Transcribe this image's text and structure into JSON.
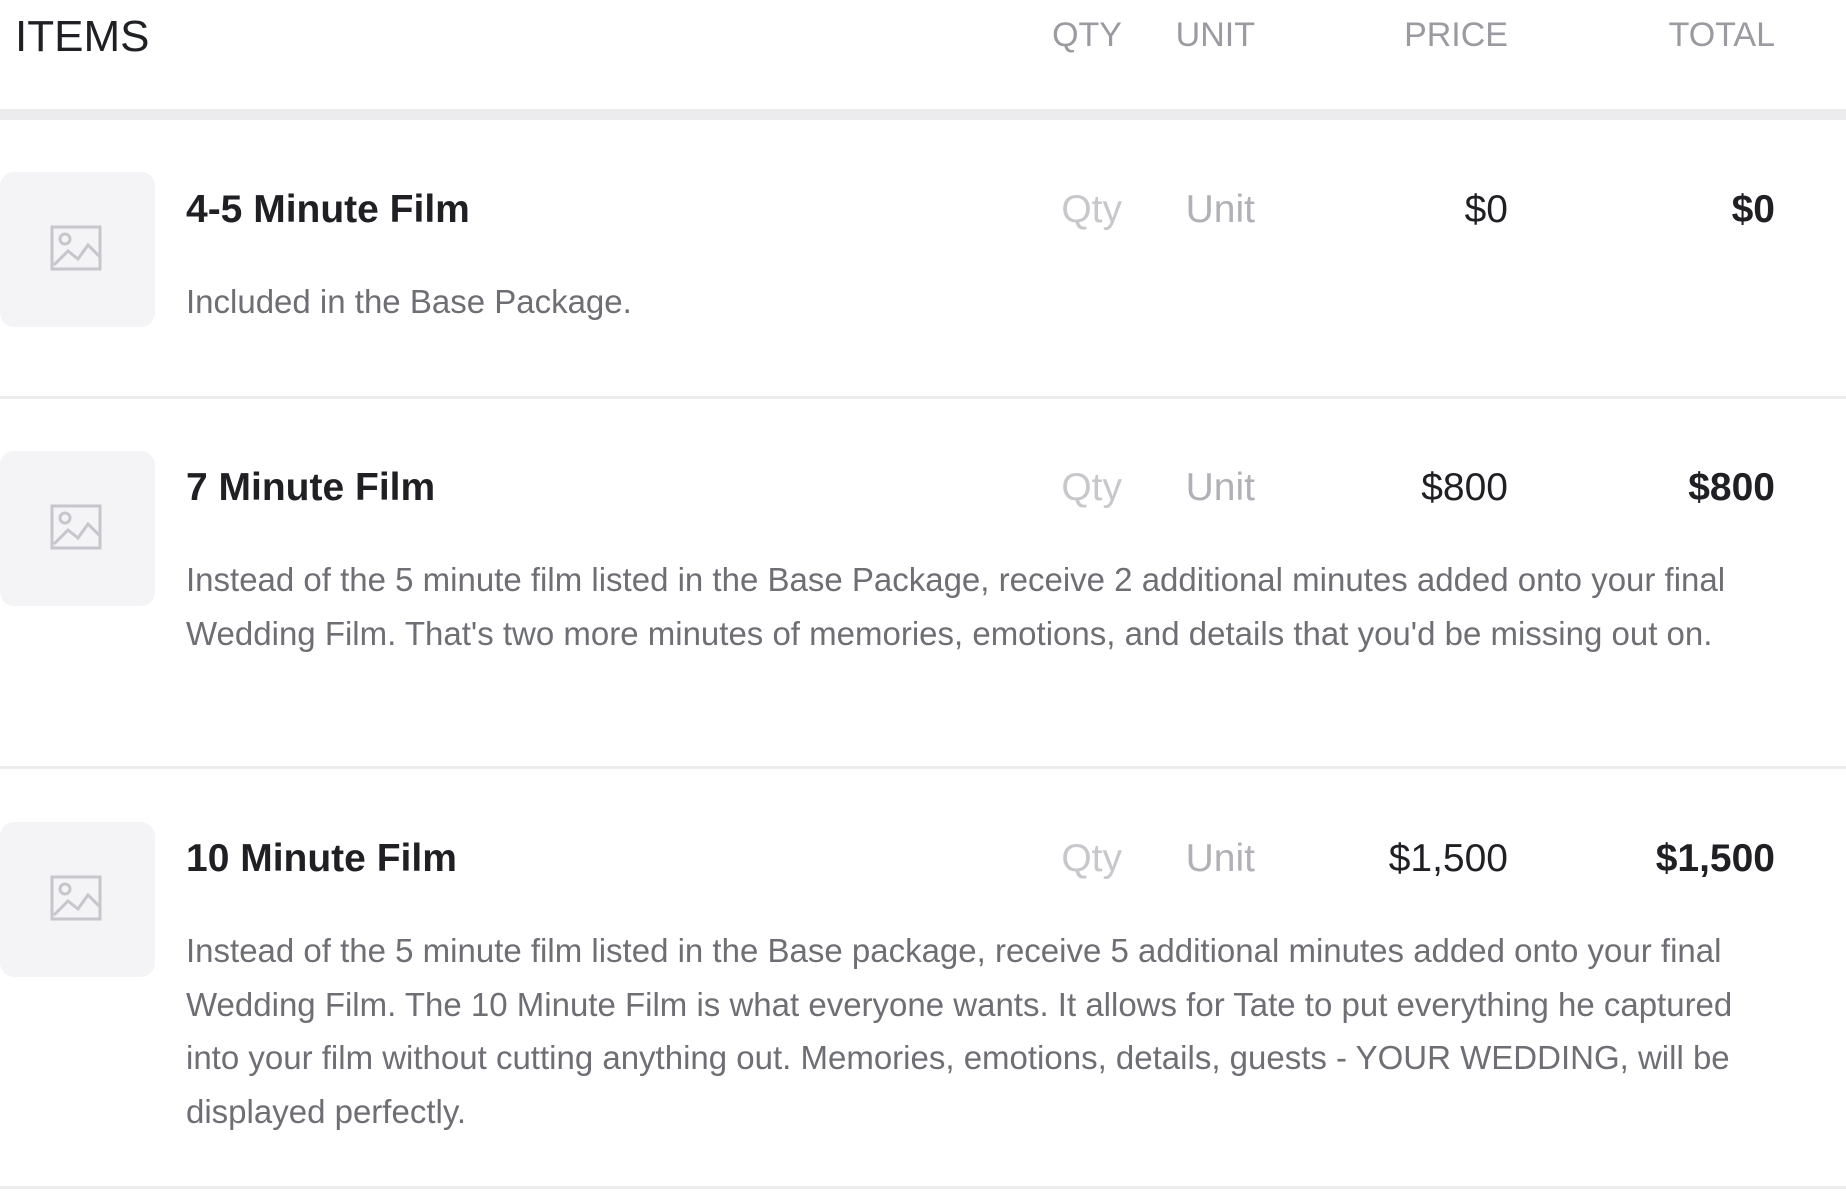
{
  "header": {
    "title": "ITEMS",
    "qty": "QTY",
    "unit": "UNIT",
    "price": "PRICE",
    "total": "TOTAL"
  },
  "items": [
    {
      "name": "4-5 Minute Film",
      "qty": "Qty",
      "unit": "Unit",
      "price": "$0",
      "total": "$0",
      "description": "Included in the Base Package.",
      "image_icon": "image-placeholder-icon"
    },
    {
      "name": "7 Minute Film",
      "qty": "Qty",
      "unit": "Unit",
      "price": "$800",
      "total": "$800",
      "description": "Instead of the 5 minute film listed in the Base Package, receive 2 additional minutes added onto your final Wedding Film. That's two more minutes of memories, emotions, and details that you'd be missing out on.",
      "image_icon": "image-placeholder-icon"
    },
    {
      "name": "10 Minute Film",
      "qty": "Qty",
      "unit": "Unit",
      "price": "$1,500",
      "total": "$1,500",
      "description": "Instead of the 5 minute film listed in the Base package, receive 5 additional minutes added onto your final Wedding Film. The 10 Minute Film is what everyone wants. It allows for Tate to put everything he captured into your film without cutting anything out. Memories, emotions, details, guests - YOUR WEDDING, will be displayed perfectly.",
      "image_icon": "image-placeholder-icon"
    }
  ]
}
